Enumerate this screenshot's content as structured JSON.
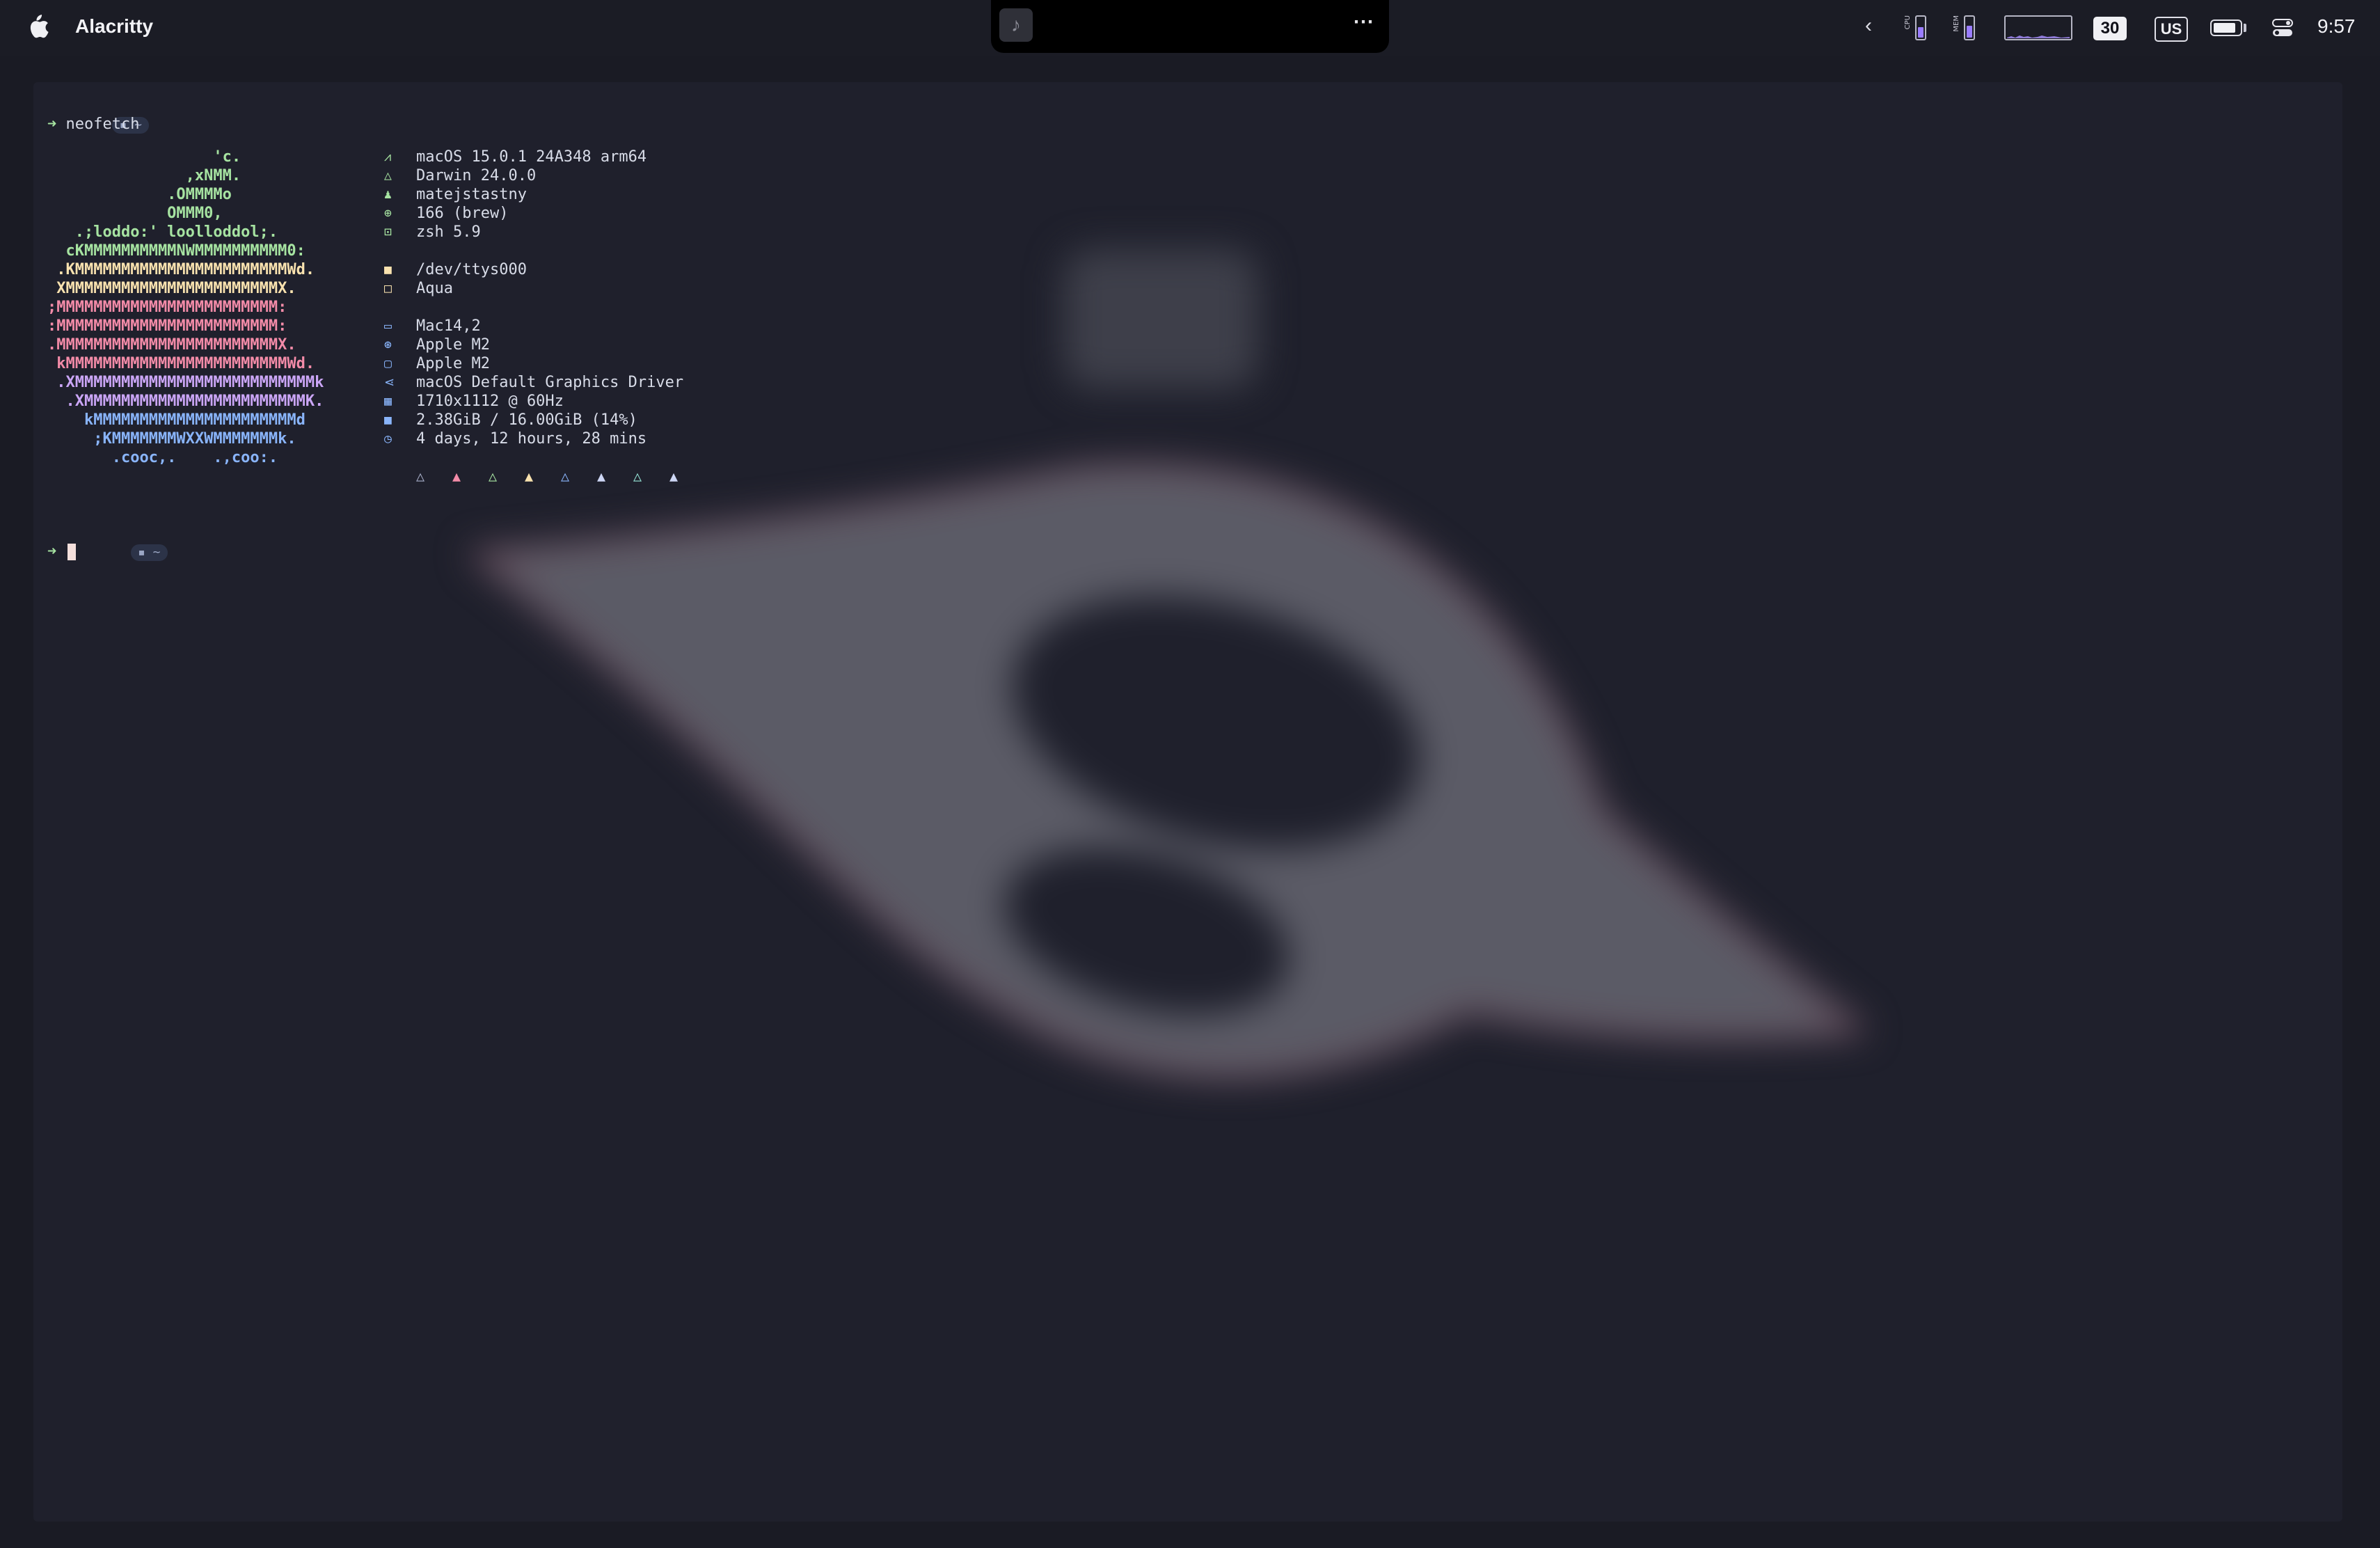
{
  "menubar": {
    "app_name": "Alacritty",
    "notch_more": "⋯",
    "music_icon": "music-note-icon",
    "chevron": "‹",
    "cpu_label": "CPU",
    "mem_label": "MEM",
    "cpu_level": 0.55,
    "mem_level": 0.6,
    "date_badge": "30",
    "keyboard_layout": "US",
    "clock": "9:57",
    "battery_level": 0.85,
    "colors": {
      "accent": "#9a7dff",
      "bar": "#1b1c25"
    }
  },
  "terminal": {
    "dir": "~",
    "command": "neofetch",
    "prompt_arrow": "➜",
    "ascii_art": [
      {
        "text": "                  'c.",
        "color": "#a6e3a1"
      },
      {
        "text": "               ,xNMM.",
        "color": "#a6e3a1"
      },
      {
        "text": "             .OMMMMo",
        "color": "#a6e3a1"
      },
      {
        "text": "             OMMM0,",
        "color": "#a6e3a1"
      },
      {
        "text": "   .;loddo:' loolloddol;.",
        "color": "#a6e3a1"
      },
      {
        "text": "  cKMMMMMMMMMMNWMMMMMMMMMM0:",
        "color": "#a6e3a1"
      },
      {
        "text": " .KMMMMMMMMMMMMMMMMMMMMMMMWd.",
        "color": "#f9e2af"
      },
      {
        "text": " XMMMMMMMMMMMMMMMMMMMMMMMX.",
        "color": "#f9e2af"
      },
      {
        "text": ";MMMMMMMMMMMMMMMMMMMMMMMM:",
        "color": "#f38ba8"
      },
      {
        "text": ":MMMMMMMMMMMMMMMMMMMMMMMM:",
        "color": "#f38ba8"
      },
      {
        "text": ".MMMMMMMMMMMMMMMMMMMMMMMMX.",
        "color": "#f38ba8"
      },
      {
        "text": " kMMMMMMMMMMMMMMMMMMMMMMMMWd.",
        "color": "#f38ba8"
      },
      {
        "text": " .XMMMMMMMMMMMMMMMMMMMMMMMMMMk",
        "color": "#cba6f7"
      },
      {
        "text": "  .XMMMMMMMMMMMMMMMMMMMMMMMMK.",
        "color": "#cba6f7"
      },
      {
        "text": "    kMMMMMMMMMMMMMMMMMMMMMMd",
        "color": "#89b4fa"
      },
      {
        "text": "     ;KMMMMMMMWXXWMMMMMMMk.",
        "color": "#89b4fa"
      },
      {
        "text": "       .cooc,.    .,coo:.",
        "color": "#89b4fa"
      }
    ],
    "info_groups": [
      {
        "color": "#a6e3a1",
        "lines": [
          {
            "icon": "os-icon",
            "glyph": "⩘",
            "text": "macOS 15.0.1 24A348 arm64"
          },
          {
            "icon": "kernel-icon",
            "glyph": "△",
            "text": "Darwin 24.0.0"
          },
          {
            "icon": "user-icon",
            "glyph": "♟",
            "text": "matejstastny"
          },
          {
            "icon": "packages-icon",
            "glyph": "⊕",
            "text": "166 (brew)"
          },
          {
            "icon": "shell-icon",
            "glyph": "⊡",
            "text": "zsh 5.9"
          }
        ]
      },
      {
        "color": "#f9e2af",
        "lines": [
          {
            "icon": "terminal-icon",
            "glyph": "■",
            "text": "/dev/ttys000"
          },
          {
            "icon": "theme-icon",
            "glyph": "□",
            "text": "Aqua"
          }
        ]
      },
      {
        "color": "#89b4fa",
        "lines": [
          {
            "icon": "host-icon",
            "glyph": "▭",
            "text": "Mac14,2"
          },
          {
            "icon": "cpu-icon",
            "glyph": "⊛",
            "text": "Apple M2"
          },
          {
            "icon": "gpu-icon",
            "glyph": "▢",
            "text": "Apple M2"
          },
          {
            "icon": "gpu-driver-icon",
            "glyph": "⋖",
            "text": "macOS Default Graphics Driver"
          },
          {
            "icon": "resolution-icon",
            "glyph": "▦",
            "text": "1710x1112 @ 60Hz"
          },
          {
            "icon": "memory-icon",
            "glyph": "■",
            "text": "2.38GiB / 16.00GiB (14%)"
          },
          {
            "icon": "uptime-icon",
            "glyph": "◷",
            "text": "4 days, 12 hours, 28 mins"
          }
        ]
      }
    ],
    "palette": [
      {
        "glyph": "△",
        "color": "#a6adc8"
      },
      {
        "glyph": "▲",
        "color": "#f38ba8"
      },
      {
        "glyph": "△",
        "color": "#a6e3a1"
      },
      {
        "glyph": "▲",
        "color": "#f9e2af"
      },
      {
        "glyph": "△",
        "color": "#89b4fa"
      },
      {
        "glyph": "▲",
        "color": "#cdd6f4"
      },
      {
        "glyph": "△",
        "color": "#94e2d5"
      },
      {
        "glyph": "▲",
        "color": "#cdd6f4"
      }
    ]
  }
}
